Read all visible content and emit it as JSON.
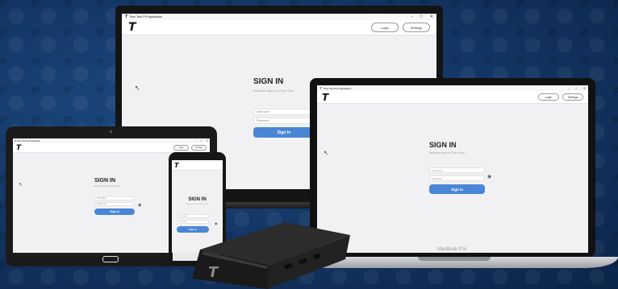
{
  "app": {
    "window_title": "Theo Tech PVI Application",
    "logo_glyph": "T",
    "login_label": "Login",
    "settings_label": "Settings",
    "signin_title": "SIGN IN",
    "signin_subtitle": "Welcome back to Theo Tech",
    "username_placeholder": "Username",
    "password_placeholder": "Password",
    "signin_button": "Sign In",
    "window_controls": [
      "–",
      "□",
      "✕"
    ]
  },
  "laptop": {
    "brand_label": "MacBook Pro"
  },
  "colors": {
    "accent": "#4a86d6",
    "background": "#143868",
    "screen": "#f1f1f3"
  },
  "icons": [
    "eye-icon",
    "cursor-icon",
    "logo-icon"
  ]
}
